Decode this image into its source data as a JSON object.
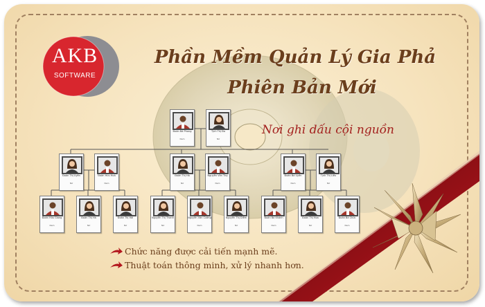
{
  "logo": {
    "line1": "AKB",
    "line2": "SOFTWARE"
  },
  "headline": {
    "line1": "Phần Mềm Quản Lý Gia Phả",
    "line2": "Phiên Bản Mới"
  },
  "slogan": "Nơi ghi dấu cội nguồn",
  "features": [
    "Chức năng được cải tiến mạnh mẽ.",
    "Thuật toán thông minh, xử lý nhanh hơn."
  ],
  "tree": {
    "gen1": [
      {
        "name": "Đoàn Bá Phong",
        "sub": "Nam",
        "gender": "m"
      },
      {
        "name": "Tịnh Thị Đa",
        "sub": "Nữ",
        "gender": "f"
      }
    ],
    "gen2": [
      {
        "name": "Đoàn Thị Uyên",
        "sub": "Nữ",
        "gender": "f"
      },
      {
        "name": "Đoàn Hữu Hoà",
        "sub": "Nam",
        "gender": "m"
      },
      {
        "name": "Đoàn Thị Hà",
        "sub": "Nữ",
        "gender": "f"
      },
      {
        "name": "Nguyễn Văn Thọ",
        "sub": "Nam",
        "gender": "m"
      },
      {
        "name": "Đoàn Bá Uyên",
        "sub": "Nam",
        "gender": "m"
      },
      {
        "name": "Tịnh Thị Liêu",
        "sub": "Nữ",
        "gender": "f"
      }
    ],
    "gen3": [
      {
        "name": "Đoàn Hữu Giang",
        "sub": "Nam",
        "gender": "m"
      },
      {
        "name": "Đoàn Thị Hà",
        "sub": "Nữ",
        "gender": "f"
      },
      {
        "name": "Đoàn Thị Hải",
        "sub": "Nữ",
        "gender": "f"
      },
      {
        "name": "Nguyễn Thị Thanh",
        "sub": "Nữ",
        "gender": "f"
      },
      {
        "name": "Nguyễn Văn Cường",
        "sub": "Nam",
        "gender": "m"
      },
      {
        "name": "Nguyễn Thị Diễm",
        "sub": "Nữ",
        "gender": "f"
      },
      {
        "name": "Đoàn Bá Khánh",
        "sub": "Nam",
        "gender": "m"
      },
      {
        "name": "Đoàn Thị Hoa",
        "sub": "Nữ",
        "gender": "f"
      },
      {
        "name": "Đoàn Bá Chức",
        "sub": "Nam",
        "gender": "m"
      }
    ]
  },
  "colors": {
    "background": "#f6e3bd",
    "border_dash": "#a08060",
    "headline": "#6b3e1c",
    "slogan": "#a3201e",
    "logo_red": "#d8262e",
    "logo_gray": "#8d8d92",
    "ribbon": "#b3171e",
    "bow": "#d9c49a"
  }
}
